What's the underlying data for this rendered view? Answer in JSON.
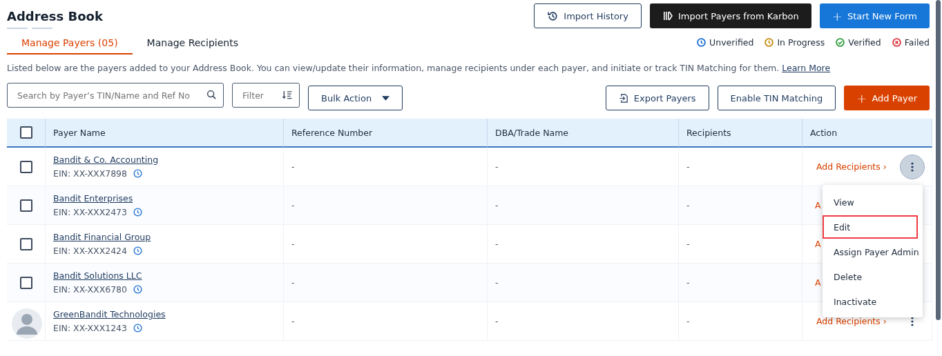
{
  "page": {
    "title": "Address Book"
  },
  "header_buttons": [
    {
      "kind": "history",
      "label": "Import History"
    },
    {
      "kind": "karbon",
      "label": "Import Payers from Karbon"
    },
    {
      "kind": "primary",
      "label": "Start New Form",
      "icon": "+"
    }
  ],
  "tabs": [
    {
      "label": "Manage Payers (05)",
      "selected": true
    },
    {
      "label": "Manage Recipients",
      "selected": false
    }
  ],
  "legend": [
    {
      "label": "Unverified",
      "kind": "clock",
      "color": "#1a6fd1"
    },
    {
      "label": "In Progress",
      "kind": "clock",
      "color": "#c48a10"
    },
    {
      "label": "Verified",
      "kind": "check",
      "color": "#2f9a3c"
    },
    {
      "label": "Failed",
      "kind": "cross",
      "color": "#d9363e"
    }
  ],
  "description": {
    "text": "Listed below are the payers added to your Address Book. You can view/update their information, manage recipients under each payer, and initiate or track TIN Matching for them.",
    "link": "Learn More"
  },
  "search": {
    "placeholder": "Search by Payer’s TIN/Name and Ref No"
  },
  "filter": {
    "placeholder": "Filter"
  },
  "bulk_action": {
    "label": "Bulk Action"
  },
  "toolbar_buttons": [
    {
      "kind": "export",
      "label": "Export Payers"
    },
    {
      "kind": "outline",
      "label": "Enable TIN Matching"
    },
    {
      "kind": "add",
      "label": "Add Payer",
      "icon": "+"
    }
  ],
  "table": {
    "select_all_checked": false,
    "columns": [
      "Payer Name",
      "Reference Number",
      "DBA/Trade Name",
      "Recipients",
      "Action"
    ],
    "rows": [
      {
        "checked": false,
        "name": "Bandit & Co. Accounting",
        "ein": "EIN: XX-XXX7898",
        "reference": "-",
        "dba": "-",
        "recipients": "-",
        "action": "Add Recipients",
        "chevron": "›",
        "menu_open": true
      },
      {
        "checked": false,
        "name": "Bandit Enterprises",
        "ein": "EIN: XX-XXX2473",
        "reference": "-",
        "dba": "-",
        "recipients": "-",
        "action": "A"
      },
      {
        "checked": false,
        "name": "Bandit Financial Group",
        "ein": "EIN: XX-XXX2424",
        "reference": "-",
        "dba": "-",
        "recipients": "-",
        "action": "A"
      },
      {
        "checked": false,
        "name": "Bandit Solutions LLC",
        "ein": "EIN: XX-XXX6780",
        "reference": "-",
        "dba": "-",
        "recipients": "-",
        "action": "A"
      },
      {
        "name": "GreenBandit Technologies",
        "ein": "EIN: XX-XXX1243",
        "reference": "-",
        "dba": "-",
        "recipients": "-",
        "action": "Add Recipients",
        "chevron": "›",
        "menu_open": false
      }
    ]
  },
  "action_menu": [
    {
      "label": "View",
      "highlighted": false
    },
    {
      "label": "Edit",
      "highlighted": true
    },
    {
      "label": "Assign Payer Admin",
      "highlighted": false
    },
    {
      "label": "Delete",
      "highlighted": false
    },
    {
      "label": "Inactivate",
      "highlighted": false
    }
  ]
}
